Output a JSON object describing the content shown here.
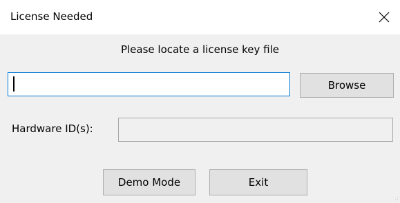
{
  "window": {
    "title": "License Needed",
    "close_icon": "close-icon"
  },
  "prompt": "Please locate a license key file",
  "key_file": {
    "value": "",
    "browse_label": "Browse"
  },
  "hardware": {
    "label": "Hardware ID(s):",
    "value": ""
  },
  "actions": {
    "demo_label": "Demo Mode",
    "exit_label": "Exit"
  },
  "colors": {
    "focus_border": "#0078d7",
    "button_face": "#e1e1e1",
    "dialog_bg": "#f0f0f0"
  }
}
